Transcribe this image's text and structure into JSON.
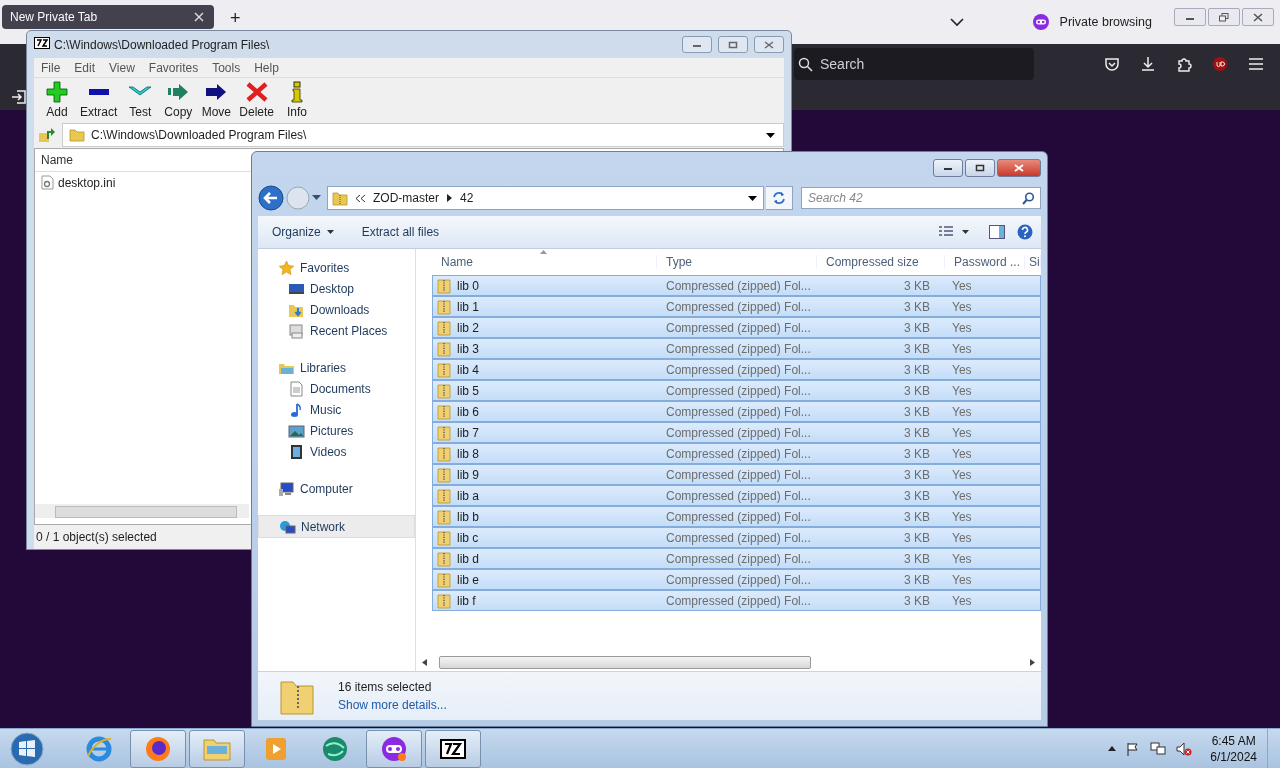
{
  "browser": {
    "tab_title": "New Private Tab",
    "new_tab": "+",
    "private_label": "Private browsing",
    "search_placeholder": "Search"
  },
  "sevenzip": {
    "title": "C:\\Windows\\Downloaded Program Files\\",
    "menu": [
      "File",
      "Edit",
      "View",
      "Favorites",
      "Tools",
      "Help"
    ],
    "toolbar": [
      {
        "label": "Add",
        "kind": "add"
      },
      {
        "label": "Extract",
        "kind": "extract"
      },
      {
        "label": "Test",
        "kind": "test"
      },
      {
        "label": "Copy",
        "kind": "copy"
      },
      {
        "label": "Move",
        "kind": "move"
      },
      {
        "label": "Delete",
        "kind": "delete"
      },
      {
        "label": "Info",
        "kind": "info"
      }
    ],
    "path": "C:\\Windows\\Downloaded Program Files\\",
    "columns": [
      "Name"
    ],
    "files": [
      {
        "name": "desktop.ini"
      }
    ],
    "status": "0 / 1 object(s) selected"
  },
  "explorer": {
    "breadcrumb": [
      "ZOD-master",
      "42"
    ],
    "search_placeholder": "Search 42",
    "commands": [
      {
        "label": "Organize",
        "dropdown": true
      },
      {
        "label": "Extract all files",
        "dropdown": false
      }
    ],
    "nav": [
      {
        "label": "Favorites",
        "kind": "star",
        "selected": false,
        "children": [
          {
            "label": "Desktop",
            "kind": "desktop",
            "selected": false
          },
          {
            "label": "Downloads",
            "kind": "downloads",
            "selected": false
          },
          {
            "label": "Recent Places",
            "kind": "recent",
            "selected": false
          }
        ]
      },
      {
        "label": "Libraries",
        "kind": "library",
        "selected": false,
        "children": [
          {
            "label": "Documents",
            "kind": "documents",
            "selected": false
          },
          {
            "label": "Music",
            "kind": "music",
            "selected": false
          },
          {
            "label": "Pictures",
            "kind": "pictures",
            "selected": false
          },
          {
            "label": "Videos",
            "kind": "videos",
            "selected": false
          }
        ]
      },
      {
        "label": "Computer",
        "kind": "computer",
        "selected": false
      },
      {
        "label": "Network",
        "kind": "network",
        "selected": true
      }
    ],
    "columns": [
      "Name",
      "Type",
      "Compressed size",
      "Password ...",
      "Si"
    ],
    "rows": [
      {
        "name": "lib 0",
        "type": "Compressed (zipped) Fol...",
        "size": "3 KB",
        "password": "Yes",
        "selected": true
      },
      {
        "name": "lib 1",
        "type": "Compressed (zipped) Fol...",
        "size": "3 KB",
        "password": "Yes",
        "selected": true
      },
      {
        "name": "lib 2",
        "type": "Compressed (zipped) Fol...",
        "size": "3 KB",
        "password": "Yes",
        "selected": true
      },
      {
        "name": "lib 3",
        "type": "Compressed (zipped) Fol...",
        "size": "3 KB",
        "password": "Yes",
        "selected": true
      },
      {
        "name": "lib 4",
        "type": "Compressed (zipped) Fol...",
        "size": "3 KB",
        "password": "Yes",
        "selected": true
      },
      {
        "name": "lib 5",
        "type": "Compressed (zipped) Fol...",
        "size": "3 KB",
        "password": "Yes",
        "selected": true
      },
      {
        "name": "lib 6",
        "type": "Compressed (zipped) Fol...",
        "size": "3 KB",
        "password": "Yes",
        "selected": true
      },
      {
        "name": "lib 7",
        "type": "Compressed (zipped) Fol...",
        "size": "3 KB",
        "password": "Yes",
        "selected": true
      },
      {
        "name": "lib 8",
        "type": "Compressed (zipped) Fol...",
        "size": "3 KB",
        "password": "Yes",
        "selected": true
      },
      {
        "name": "lib 9",
        "type": "Compressed (zipped) Fol...",
        "size": "3 KB",
        "password": "Yes",
        "selected": true
      },
      {
        "name": "lib a",
        "type": "Compressed (zipped) Fol...",
        "size": "3 KB",
        "password": "Yes",
        "selected": true
      },
      {
        "name": "lib b",
        "type": "Compressed (zipped) Fol...",
        "size": "3 KB",
        "password": "Yes",
        "selected": true
      },
      {
        "name": "lib c",
        "type": "Compressed (zipped) Fol...",
        "size": "3 KB",
        "password": "Yes",
        "selected": true
      },
      {
        "name": "lib d",
        "type": "Compressed (zipped) Fol...",
        "size": "3 KB",
        "password": "Yes",
        "selected": true
      },
      {
        "name": "lib e",
        "type": "Compressed (zipped) Fol...",
        "size": "3 KB",
        "password": "Yes",
        "selected": true
      },
      {
        "name": "lib f",
        "type": "Compressed (zipped) Fol...",
        "size": "3 KB",
        "password": "Yes",
        "selected": true
      }
    ],
    "status": {
      "count": "16 items selected",
      "link": "Show more details..."
    }
  },
  "taskbar": {
    "apps": [
      {
        "kind": "ie",
        "running": false
      },
      {
        "kind": "firefox",
        "running": true
      },
      {
        "kind": "explorer",
        "running": true
      },
      {
        "kind": "media",
        "running": false
      },
      {
        "kind": "globe",
        "running": false
      },
      {
        "kind": "private",
        "running": true
      },
      {
        "kind": "sevenzip",
        "running": true
      }
    ],
    "time": "6:45 AM",
    "date": "6/1/2024"
  }
}
